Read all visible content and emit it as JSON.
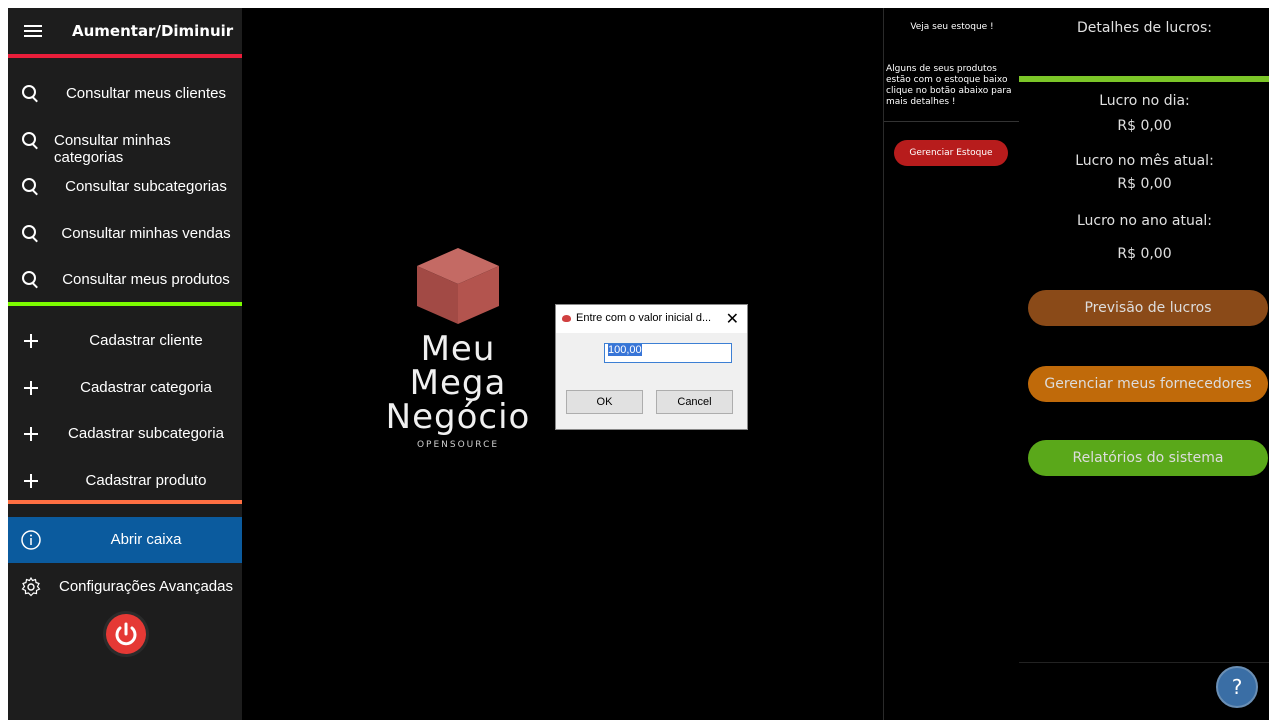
{
  "sidebar": {
    "title": "Aumentar/Diminuir",
    "search_items": [
      {
        "label": "Consultar meus clientes"
      },
      {
        "label": "Consultar minhas categorias"
      },
      {
        "label": "Consultar subcategorias"
      },
      {
        "label": "Consultar minhas vendas"
      },
      {
        "label": "Consultar meus produtos"
      }
    ],
    "add_items": [
      {
        "label": "Cadastrar cliente"
      },
      {
        "label": "Cadastrar categoria"
      },
      {
        "label": "Cadastrar subcategoria"
      },
      {
        "label": "Cadastrar produto"
      }
    ],
    "open_cash": "Abrir caixa",
    "advanced": "Configurações Avançadas",
    "colors": {
      "header_line": "#e91e3a",
      "search_line": "#7cfc00",
      "add_line": "#ff7043",
      "active": "#0b5b9e"
    }
  },
  "logo": {
    "line1": "Meu",
    "line2": "Mega",
    "line3": "Negócio",
    "sub": "OPENSOURCE"
  },
  "stock": {
    "title": "Veja seu estoque !",
    "message": "Alguns de seus produtos estão com o estoque baixo clique no botão abaixo para mais detalhes !",
    "button": "Gerenciar Estoque"
  },
  "profit": {
    "title": "Detalhes de lucros:",
    "day_label": "Lucro no dia:",
    "day_value": "R$ 0,00",
    "month_label": "Lucro no mês atual:",
    "month_value": "R$ 0,00",
    "year_label": "Lucro no ano atual:",
    "year_value": "R$ 0,00",
    "buttons": [
      {
        "label": "Previsão de lucros",
        "color": "#8a4a18"
      },
      {
        "label": "Gerenciar meus fornecedores",
        "color": "#c06a0a"
      },
      {
        "label": "Relatórios do sistema",
        "color": "#5aa81a"
      }
    ],
    "help": "?"
  },
  "dialog": {
    "title": "Entre com o valor inicial d...",
    "close": "✕",
    "value": "100,00",
    "ok": "OK",
    "cancel": "Cancel"
  }
}
